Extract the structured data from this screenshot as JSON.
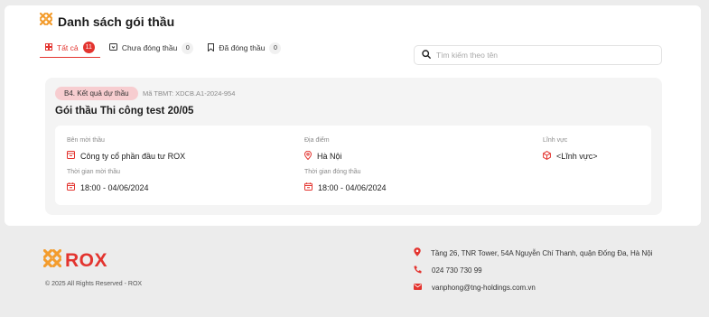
{
  "page": {
    "title": "Danh sách gói thầu"
  },
  "tabs": [
    {
      "label": "Tất cả",
      "count": "11"
    },
    {
      "label": "Chưa đóng thầu",
      "count": "0"
    },
    {
      "label": "Đã đóng thầu",
      "count": "0"
    }
  ],
  "search": {
    "placeholder": "Tìm kiếm theo tên"
  },
  "card": {
    "status": "B4. Kết quả dự thầu",
    "code": "Mã TBMT: XDCB.A1-2024-954",
    "title": "Gói thầu Thi công test 20/05",
    "inviter_label": "Bên mời thầu",
    "inviter_value": "Công ty cổ phần đầu tư ROX",
    "location_label": "Địa điểm",
    "location_value": "Hà Nội",
    "field_label": "Lĩnh vực",
    "field_value": "<Lĩnh vực>",
    "invite_time_label": "Thời gian mời thầu",
    "invite_time_value": "18:00 - 04/06/2024",
    "close_time_label": "Thời gian đóng thầu",
    "close_time_value": "18:00 - 04/06/2024"
  },
  "footer": {
    "logo": "ROX",
    "copyright": "© 2025 All Rights Reserved -  ROX",
    "address": "Tầng 26, TNR Tower, 54A Nguyễn Chí Thanh, quận Đống Đa, Hà Nội",
    "phone": "024 730 730 99",
    "email": "vanphong@tng-holdings.com.vn"
  },
  "colors": {
    "accent": "#e3342f",
    "logo_orange": "#f39c2d",
    "badge_bg": "#f7cdd0"
  },
  "icons": [
    "rox-mark-icon",
    "grid-icon",
    "inbox-icon",
    "bookmark-icon",
    "search-icon",
    "building-icon",
    "location-pin-icon",
    "cube-icon",
    "calendar-icon",
    "phone-icon",
    "mail-icon"
  ]
}
